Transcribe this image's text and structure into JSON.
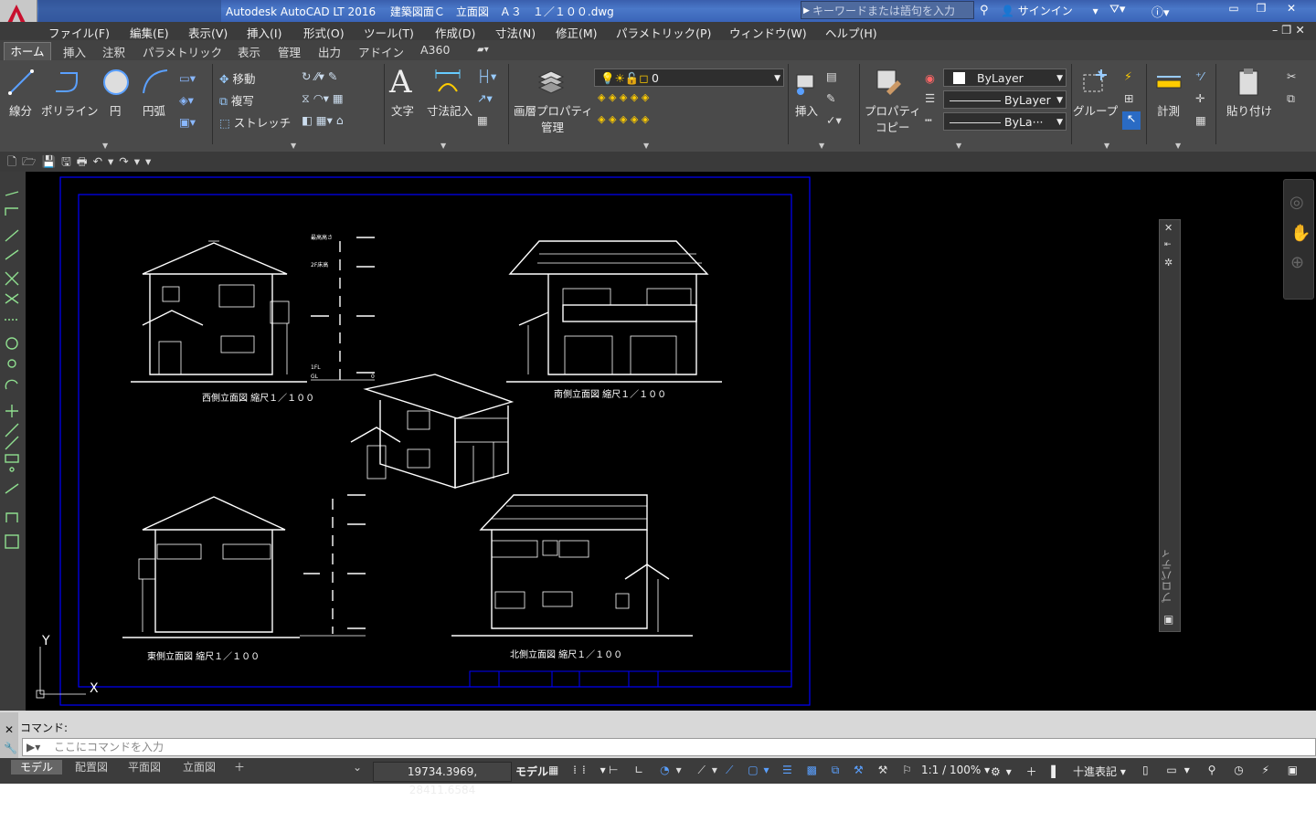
{
  "title": "Autodesk AutoCAD LT 2016　 建築図面Ｃ　立面図　Ａ３　１／１００.dwg",
  "logo_text": "LT",
  "search_placeholder": "キーワードまたは語句を入力",
  "signin": "サインイン",
  "menu": [
    "ファイル(F)",
    "編集(E)",
    "表示(V)",
    "挿入(I)",
    "形式(O)",
    "ツール(T)",
    "作成(D)",
    "寸法(N)",
    "修正(M)",
    "パラメトリック(P)",
    "ウィンドウ(W)",
    "ヘルプ(H)"
  ],
  "ribbon_tabs": [
    "ホーム",
    "挿入",
    "注釈",
    "パラメトリック",
    "表示",
    "管理",
    "出力",
    "アドイン",
    "A360"
  ],
  "ribbon": {
    "draw": {
      "line": "線分",
      "polyline": "ポリライン",
      "circle": "円",
      "arc": "円弧"
    },
    "modify": {
      "move": "移動",
      "copy": "複写",
      "stretch": "ストレッチ"
    },
    "annotation": {
      "text": "文字",
      "dimension": "寸法記入"
    },
    "layers": {
      "layer_props": "画層プロパティ",
      "layer_props2": "管理",
      "current_layer": "0"
    },
    "block": {
      "insert": "挿入"
    },
    "properties": {
      "match": "プロパティ",
      "match2": "コピー",
      "color": "ByLayer",
      "linetype": "ByLayer",
      "lineweight": "ByLa···"
    },
    "groups": {
      "group": "グループ"
    },
    "utilities": {
      "measure": "計測"
    },
    "clipboard": {
      "paste": "貼り付け"
    }
  },
  "drawing": {
    "west": "西側立面図 縮尺１／１００",
    "south": "南側立面図 縮尺１／１００",
    "east": "東側立面図 縮尺１／１００",
    "north": "北側立面図 縮尺１／１００",
    "level_max": "最高高さ",
    "level_2f": "2F床高",
    "level_1f": "1FL",
    "level_gl": "GL",
    "zero": "0",
    "ucs_y": "Y",
    "ucs_x": "X"
  },
  "properties_palette": "プロパティ",
  "command_history": "コマンド:",
  "command_placeholder": "ここにコマンドを入力",
  "layout_tabs": [
    "モデル",
    "配置図",
    "平面図",
    "立面図"
  ],
  "status": {
    "coords": "19734.3969, 28411.6584",
    "model": "モデル",
    "scale": "1:1 / 100%",
    "units": "十進表記"
  },
  "colors": {
    "accent": "#1a66d6",
    "border_blue": "#0000ff",
    "canvas": "#000000"
  }
}
